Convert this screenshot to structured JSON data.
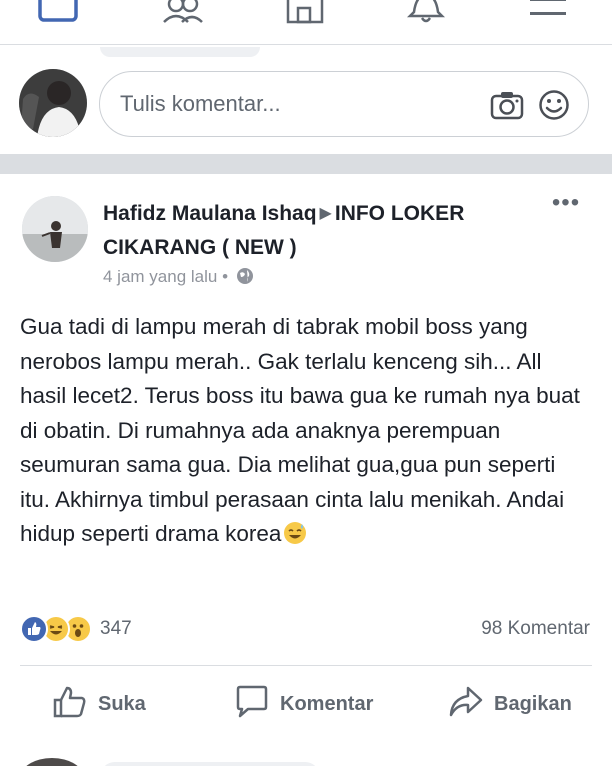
{
  "nav": {
    "icons": [
      "feed-icon",
      "friends-icon",
      "marketplace-icon",
      "notifications-icon",
      "menu-icon"
    ]
  },
  "composer": {
    "placeholder": "Tulis komentar...",
    "icons": [
      "camera-icon",
      "emoji-icon"
    ]
  },
  "post": {
    "author": "Hafidz Maulana Ishaq",
    "group": "INFO LOKER CIKARANG ( NEW )",
    "timestamp": "4 jam yang lalu",
    "privacy_separator": "•",
    "more_label": "•••",
    "text": "Gua tadi di lampu merah di tabrak mobil boss yang nerobos lampu merah.. Gak terlalu kenceng sih... All hasil lecet2. Terus boss itu bawa gua ke rumah nya buat di obatin. Di rumahnya ada anaknya perempuan seumuran sama gua. Dia melihat gua,gua pun seperti itu. Akhirnya timbul perasaan cinta lalu menikah. Andai hidup seperti drama korea",
    "reactions": {
      "types": [
        "like",
        "haha",
        "wow"
      ],
      "count": "347"
    },
    "comment_count": "98 Komentar",
    "actions": {
      "like": "Suka",
      "comment": "Komentar",
      "share": "Bagikan"
    }
  },
  "colors": {
    "like_blue": "#4267b2",
    "reaction_yellow": "#f7c948",
    "text_secondary": "#606770",
    "divider": "#dadde1"
  }
}
